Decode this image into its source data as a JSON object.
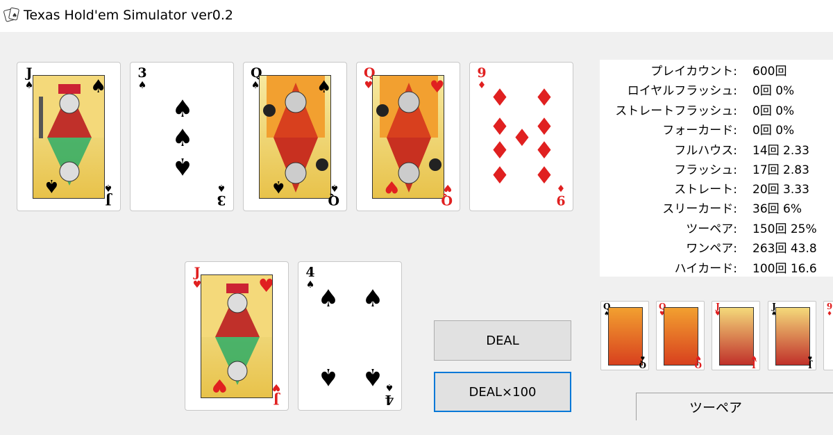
{
  "window": {
    "title": "Texas Hold'em Simulator ver0.2"
  },
  "board": [
    {
      "rank": "J",
      "suit": "♠",
      "color": "black",
      "kind": "face"
    },
    {
      "rank": "3",
      "suit": "♠",
      "color": "black",
      "kind": "pips"
    },
    {
      "rank": "Q",
      "suit": "♠",
      "color": "black",
      "kind": "face"
    },
    {
      "rank": "Q",
      "suit": "♥",
      "color": "red",
      "kind": "face"
    },
    {
      "rank": "9",
      "suit": "♦",
      "color": "red",
      "kind": "pips"
    }
  ],
  "hand": [
    {
      "rank": "J",
      "suit": "♥",
      "color": "red",
      "kind": "face"
    },
    {
      "rank": "4",
      "suit": "♠",
      "color": "black",
      "kind": "pips"
    }
  ],
  "stats": [
    {
      "label": "プレイカウント:",
      "value": "600回"
    },
    {
      "label": "ロイヤルフラッシュ:",
      "value": "0回 0%"
    },
    {
      "label": "ストレートフラッシュ:",
      "value": "0回 0%"
    },
    {
      "label": "フォーカード:",
      "value": "0回 0%"
    },
    {
      "label": "フルハウス:",
      "value": "14回 2.33"
    },
    {
      "label": "フラッシュ:",
      "value": "17回 2.83"
    },
    {
      "label": "ストレート:",
      "value": "20回 3.33"
    },
    {
      "label": "スリーカード:",
      "value": "36回 6%"
    },
    {
      "label": "ツーペア:",
      "value": "150回 25%"
    },
    {
      "label": "ワンペア:",
      "value": "263回 43.8"
    },
    {
      "label": "ハイカード:",
      "value": "100回 16.6"
    }
  ],
  "best_hand": [
    {
      "rank": "Q",
      "suit": "♠",
      "color": "black"
    },
    {
      "rank": "Q",
      "suit": "♥",
      "color": "red"
    },
    {
      "rank": "J",
      "suit": "♥",
      "color": "red"
    },
    {
      "rank": "J",
      "suit": "♠",
      "color": "black"
    },
    {
      "rank": "9",
      "suit": "♦",
      "color": "red"
    }
  ],
  "buttons": {
    "deal": "DEAL",
    "deal100": "DEAL×100"
  },
  "result": "ツーペア",
  "colors": {
    "red": "#e02020",
    "black": "#000000",
    "focus": "#0078d7"
  }
}
